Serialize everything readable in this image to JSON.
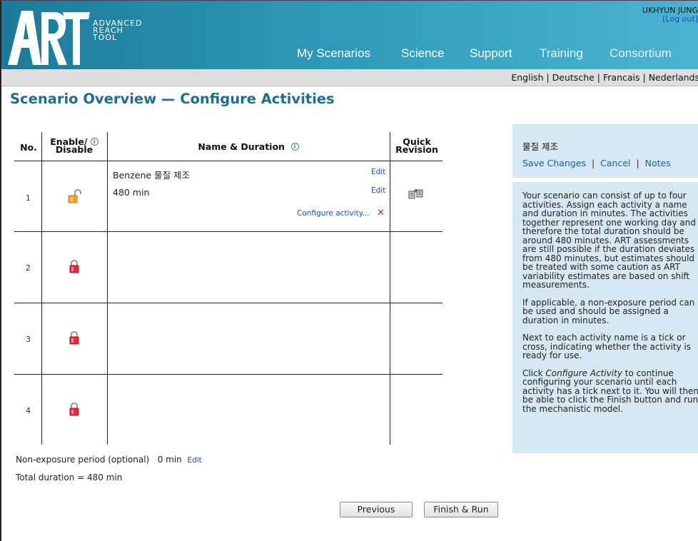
{
  "header": {
    "logo_lines": [
      "ADVANCED",
      "REACH",
      "TOOL"
    ],
    "nav": [
      "My Scenarios",
      "Science",
      "Support",
      "Training",
      "Consortium"
    ],
    "user_name": "UKHYUN JUNG",
    "logout_label": "[Log out]"
  },
  "languages": [
    "English",
    "Deutsche",
    "Francais",
    "Nederlands"
  ],
  "page_title": "Scenario Overview — Configure Activities",
  "table": {
    "headers": {
      "no": "No.",
      "enable_line1": "Enable/",
      "enable_line2": "Disable",
      "name_duration": "Name & Duration",
      "quick_line1": "Quick",
      "quick_line2": "Revision"
    },
    "rows": [
      {
        "no": "1",
        "name": "Benzene 물질 제조",
        "duration": "480 min",
        "edit_label": "Edit",
        "configure_label": "Configure activity...",
        "state": "enabled"
      },
      {
        "no": "2",
        "state": "locked"
      },
      {
        "no": "3",
        "state": "locked"
      },
      {
        "no": "4",
        "state": "locked"
      }
    ]
  },
  "non_exposure": {
    "label": "Non-exposure period (optional)",
    "value": "0 min",
    "edit_label": "Edit"
  },
  "total_duration": "Total duration = 480 min",
  "buttons": {
    "previous": "Previous",
    "finish": "Finish & Run"
  },
  "side_panel": {
    "title": "물질 제조",
    "save": "Save Changes",
    "cancel": "Cancel",
    "notes": "Notes",
    "help_p1": "Your scenario can consist of up to four activities. Assign each activity a name and duration in minutes. The activities together represent one working day and therefore the total duration should be around 480 minutes. ART assessments are still possible if the duration deviates from 480 minutes, but estimates should be treated with some caution as ART variability estimates are based on shift measurements.",
    "help_p2": "If applicable, a non-exposure period can be used and should be assigned a duration in minutes.",
    "help_p3": "Next to each activity name is a tick or cross, indicating whether the activity is ready for use.",
    "help_p4_pre": "Click ",
    "help_p4_em": "Configure Activity",
    "help_p4_post": " to continue configuring your scenario until each activity has a tick next to it. You will then be able to click the Finish button and run the mechanistic model."
  },
  "colors": {
    "header_start": "#1c7a98",
    "header_end": "#4cb3d0",
    "title": "#1b6f8c",
    "link": "#1a4fc2",
    "panel": "#d6e8f2"
  }
}
